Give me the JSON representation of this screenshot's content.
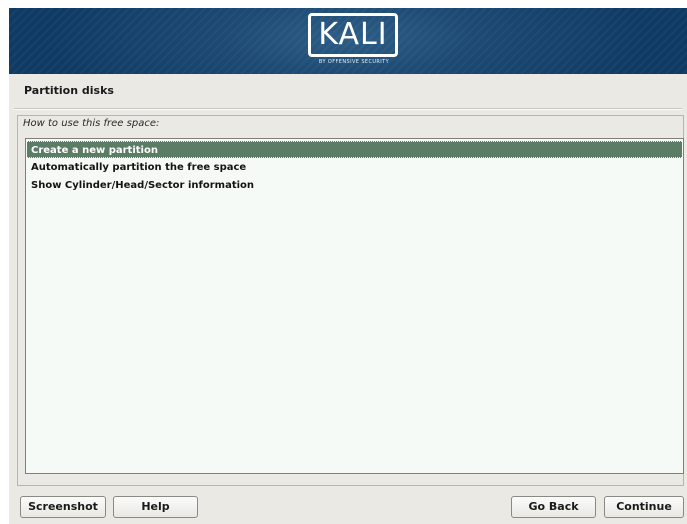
{
  "banner": {
    "logo_text": "KALI",
    "logo_subtext": "BY OFFENSIVE SECURITY"
  },
  "page": {
    "title": "Partition disks",
    "question": "How to use this free space:"
  },
  "list": {
    "items": [
      {
        "label": "Create a new partition",
        "selected": true
      },
      {
        "label": "Automatically partition the free space",
        "selected": false
      },
      {
        "label": "Show Cylinder/Head/Sector information",
        "selected": false
      }
    ]
  },
  "buttons": {
    "screenshot": "Screenshot",
    "help": "Help",
    "go_back": "Go Back",
    "continue": "Continue"
  },
  "colors": {
    "banner": "#1d4b74",
    "selection": "#5b7d66",
    "background": "#eae9e4",
    "list_background": "#f6faf7"
  }
}
